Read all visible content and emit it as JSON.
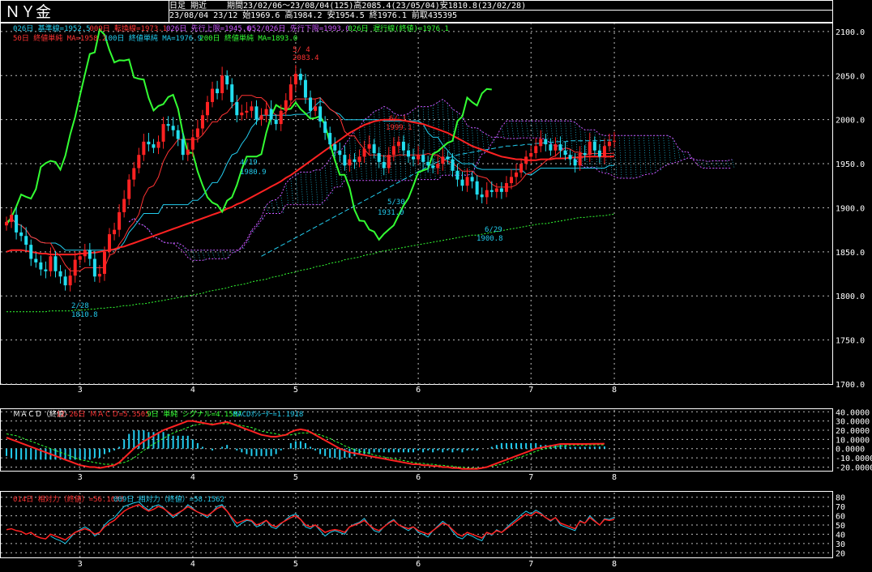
{
  "header": {
    "title": "ＮＹ金",
    "mode": "日足 期近",
    "period": "期間23/02/06～23/08/04(125)高2085.4(23/05/04)安1810.8(23/02/28)",
    "last_bar": "23/08/04 23/12 始1969.6 高1984.2 安1954.5 終1976.1 前取435395"
  },
  "legend_main": {
    "row1": [
      {
        "text": "026日 基準線=1952.5",
        "color": "#22ccee"
      },
      {
        "text": "009日 転換線=1973.1",
        "color": "#ff3333"
      },
      {
        "text": "026日 先行上限=1945.6",
        "color": "#cc55ff"
      },
      {
        "text": "052/026日 先行下限=1993.0",
        "color": "#cc55ff"
      },
      {
        "text": "026日 遅行線(終値)=1976.1",
        "color": "#33ff33"
      }
    ],
    "row2": [
      {
        "text": "50日 終値単純 MA=1958.2",
        "color": "#ff3333"
      },
      {
        "text": "100日 終値単純 MA=1976.9",
        "color": "#22ccee"
      },
      {
        "text": "200日 終値単純 MA=1893.0",
        "color": "#33ff33"
      }
    ]
  },
  "legend_macd": [
    {
      "text": "ＭＡＣＤ（終値）",
      "color": "#ffffff"
    },
    {
      "text": "12-26日 ＭＡＣＤ=5.3505",
      "color": "#ff3333"
    },
    {
      "text": "9日 単純 シグナル=4.1587",
      "color": "#33ff33"
    },
    {
      "text": "MACDｵｼﾚｰﾀｰ=1.1918",
      "color": "#22ccee"
    }
  ],
  "legend_rsi": [
    {
      "text": "014日 相対力（終値）=56.1055",
      "color": "#ff3333"
    },
    {
      "text": "009日 相対力（終値）=58.1562",
      "color": "#22ccee"
    }
  ],
  "annotations": [
    {
      "text": "5/ 4",
      "color": "#ff3333"
    },
    {
      "text": "2083.4",
      "color": "#ff3333"
    },
    {
      "text": "6/ 1",
      "color": "#ff3333"
    },
    {
      "text": "1999.1",
      "color": "#ff3333"
    },
    {
      "text": "4/19",
      "color": "#22ccee"
    },
    {
      "text": "1980.9",
      "color": "#22ccee"
    },
    {
      "text": "2/28",
      "color": "#22ccee"
    },
    {
      "text": "1810.8",
      "color": "#22ccee"
    },
    {
      "text": "5/30",
      "color": "#22ccee"
    },
    {
      "text": "1931.0",
      "color": "#22ccee"
    },
    {
      "text": "6/29",
      "color": "#22ccee"
    },
    {
      "text": "1900.8",
      "color": "#22ccee"
    }
  ],
  "colors": {
    "up": "#ff2222",
    "down": "#22ddee",
    "grid": "#bbbbbb",
    "frame": "#ffffff"
  },
  "chart_data": [
    {
      "type": "candlestick",
      "x_ticks": [
        "3",
        "4",
        "5",
        "6",
        "7",
        "8"
      ],
      "y_ticks": [
        "1700.0",
        "1750.0",
        "1800.0",
        "1850.0",
        "1900.0",
        "1950.0",
        "2000.0",
        "2050.0",
        "2100.0"
      ],
      "ylim": [
        1700,
        2110
      ],
      "close": [
        1884,
        1892,
        1872,
        1868,
        1858,
        1842,
        1838,
        1830,
        1828,
        1845,
        1828,
        1822,
        1812,
        1823,
        1841,
        1845,
        1852,
        1842,
        1822,
        1825,
        1850,
        1870,
        1875,
        1895,
        1910,
        1932,
        1945,
        1960,
        1975,
        1972,
        1968,
        1975,
        1995,
        1993,
        1988,
        1978,
        1960,
        1966,
        1980,
        1990,
        2005,
        2020,
        2035,
        2030,
        2050,
        2040,
        2020,
        2005,
        2008,
        2010,
        2015,
        2000,
        2005,
        2012,
        2000,
        1995,
        2010,
        2022,
        2040,
        2052,
        2045,
        2025,
        2010,
        2015,
        1998,
        1985,
        1972,
        1965,
        1960,
        1948,
        1955,
        1952,
        1958,
        1967,
        1972,
        1962,
        1952,
        1945,
        1960,
        1970,
        1975,
        1965,
        1958,
        1955,
        1960,
        1952,
        1948,
        1945,
        1950,
        1958,
        1955,
        1942,
        1932,
        1925,
        1935,
        1930,
        1915,
        1912,
        1920,
        1918,
        1922,
        1918,
        1928,
        1935,
        1940,
        1950,
        1958,
        1962,
        1970,
        1978,
        1972,
        1965,
        1972,
        1965,
        1960,
        1955,
        1948,
        1962,
        1960,
        1975,
        1965,
        1958,
        1970,
        1975,
        1976
      ],
      "ma50": [
        1850,
        1852,
        1852,
        1852,
        1851,
        1850,
        1849,
        1848,
        1848,
        1847,
        1847,
        1847,
        1847,
        1847,
        1847,
        1848,
        1848,
        1849,
        1849,
        1850,
        1851,
        1852,
        1853,
        1855,
        1856,
        1858,
        1860,
        1862,
        1864,
        1866,
        1868,
        1870,
        1872,
        1874,
        1876,
        1878,
        1880,
        1882,
        1884,
        1886,
        1888,
        1890,
        1892,
        1894,
        1896,
        1899,
        1901,
        1904,
        1906,
        1909,
        1912,
        1915,
        1918,
        1921,
        1924,
        1927,
        1930,
        1934,
        1937,
        1941,
        1945,
        1949,
        1953,
        1957,
        1961,
        1965,
        1969,
        1973,
        1977,
        1981,
        1985,
        1988,
        1991,
        1994,
        1996,
        1998,
        1999,
        2000,
        2000,
        2000,
        2000,
        1999,
        1998,
        1997,
        1996,
        1995,
        1993,
        1991,
        1989,
        1987,
        1985,
        1982,
        1979,
        1976,
        1973,
        1970,
        1968,
        1966,
        1964,
        1962,
        1960,
        1958,
        1957,
        1956,
        1955,
        1955,
        1954,
        1954,
        1954,
        1955,
        1955,
        1955,
        1956,
        1956,
        1956,
        1957,
        1957,
        1957,
        1958,
        1958,
        1958,
        1958,
        1958,
        1958,
        1958.2
      ],
      "ma100": [
        null,
        null,
        null,
        null,
        null,
        null,
        null,
        null,
        null,
        null,
        null,
        null,
        null,
        null,
        null,
        null,
        null,
        null,
        null,
        null,
        null,
        null,
        null,
        null,
        null,
        null,
        null,
        null,
        null,
        null,
        null,
        null,
        null,
        null,
        null,
        null,
        null,
        null,
        null,
        null,
        null,
        null,
        null,
        null,
        null,
        null,
        null,
        null,
        null,
        null,
        null,
        null,
        1845,
        1848,
        1851,
        1854,
        1857,
        1860,
        1863,
        1866,
        1869,
        1872,
        1875,
        1878,
        1881,
        1884,
        1887,
        1890,
        1893,
        1896,
        1899,
        1902,
        1905,
        1908,
        1911,
        1914,
        1917,
        1920,
        1923,
        1926,
        1929,
        1932,
        1935,
        1938,
        1941,
        1944,
        1947,
        1950,
        1952,
        1954,
        1956,
        1958,
        1960,
        1961,
        1962,
        1963,
        1964,
        1965,
        1966,
        1967,
        1968,
        1969,
        1970,
        1970,
        1971,
        1971,
        1972,
        1972,
        1973,
        1973,
        1974,
        1974,
        1975,
        1975,
        1975,
        1976,
        1976,
        1976,
        1976,
        1976,
        1976,
        1976,
        1976.5,
        1976.7,
        1976.9
      ],
      "ma200": [
        1782,
        1782,
        1782,
        1782,
        1782,
        1782,
        1782,
        1782,
        1782,
        1783,
        1783,
        1783,
        1783,
        1783,
        1784,
        1784,
        1784,
        1785,
        1785,
        1786,
        1786,
        1787,
        1787,
        1788,
        1789,
        1789,
        1790,
        1791,
        1791,
        1792,
        1793,
        1794,
        1795,
        1796,
        1797,
        1798,
        1799,
        1800,
        1801,
        1802,
        1803,
        1805,
        1806,
        1807,
        1808,
        1809,
        1811,
        1812,
        1813,
        1814,
        1816,
        1817,
        1818,
        1819,
        1821,
        1822,
        1823,
        1825,
        1826,
        1827,
        1829,
        1830,
        1831,
        1833,
        1834,
        1835,
        1837,
        1838,
        1839,
        1841,
        1842,
        1843,
        1844,
        1846,
        1847,
        1848,
        1850,
        1851,
        1852,
        1853,
        1854,
        1855,
        1856,
        1857,
        1858,
        1859,
        1860,
        1861,
        1862,
        1863,
        1864,
        1865,
        1866,
        1867,
        1868,
        1869,
        1869,
        1870,
        1871,
        1872,
        1873,
        1874,
        1875,
        1876,
        1877,
        1878,
        1879,
        1880,
        1881,
        1882,
        1882,
        1883,
        1884,
        1885,
        1886,
        1887,
        1888,
        1889,
        1889,
        1890,
        1890,
        1891,
        1891,
        1892,
        1893
      ]
    },
    {
      "type": "line",
      "name": "MACD",
      "y_ticks": [
        "40.0000",
        "30.0000",
        "20.0000",
        "10.0000",
        "0.0000",
        "-10.0000",
        "-20.0000"
      ],
      "ylim": [
        -24,
        42
      ],
      "macd": [
        12,
        10,
        8,
        6,
        4,
        2,
        0,
        -2,
        -4,
        -6,
        -8,
        -10,
        -12,
        -14,
        -16,
        -18,
        -19,
        -20,
        -20,
        -21,
        -20,
        -19,
        -18,
        -15,
        -10,
        -5,
        0,
        4,
        8,
        11,
        14,
        17,
        20,
        22,
        24,
        26,
        28,
        30,
        30,
        29,
        28,
        27,
        26,
        27,
        28,
        29,
        27,
        25,
        23,
        21,
        19,
        17,
        15,
        14,
        13,
        13,
        14,
        15,
        18,
        20,
        21,
        20,
        18,
        15,
        12,
        9,
        6,
        3,
        0,
        -2,
        -4,
        -5,
        -6,
        -7,
        -8,
        -9,
        -10,
        -11,
        -12,
        -13,
        -14,
        -15,
        -16,
        -17,
        -17,
        -18,
        -18,
        -19,
        -19,
        -20,
        -20,
        -21,
        -21,
        -22,
        -22,
        -22,
        -22,
        -21,
        -20,
        -18,
        -16,
        -14,
        -12,
        -10,
        -8,
        -6,
        -4,
        -2,
        0,
        1,
        2,
        3,
        4,
        5,
        5,
        5,
        5,
        5,
        5,
        5.1,
        5.2,
        5.3,
        5.35
      ],
      "signal": [
        16,
        15,
        14,
        12,
        10,
        8,
        6,
        4,
        2,
        0,
        -2,
        -4,
        -6,
        -8,
        -10,
        -12,
        -13,
        -14,
        -15,
        -16,
        -17,
        -17,
        -17,
        -16,
        -15,
        -13,
        -10,
        -6,
        -2,
        2,
        5,
        8,
        11,
        14,
        17,
        19,
        21,
        23,
        25,
        26,
        27,
        27,
        27,
        27,
        27,
        27,
        27,
        26,
        25,
        24,
        23,
        21,
        19,
        18,
        17,
        16,
        15,
        15,
        15,
        16,
        17,
        17,
        17,
        16,
        15,
        13,
        11,
        8,
        6,
        3,
        1,
        -1,
        -3,
        -4,
        -5,
        -7,
        -8,
        -9,
        -10,
        -11,
        -12,
        -13,
        -14,
        -15,
        -16,
        -16,
        -17,
        -17,
        -18,
        -18,
        -19,
        -19,
        -20,
        -20,
        -21,
        -21,
        -21,
        -21,
        -20,
        -19,
        -18,
        -17,
        -15,
        -13,
        -11,
        -9,
        -7,
        -5,
        -3,
        -1,
        0,
        1,
        2,
        3,
        3,
        4,
        4,
        4,
        4,
        4,
        4.1,
        4.15,
        4.16
      ]
    },
    {
      "type": "line",
      "name": "RSI",
      "y_ticks": [
        "80",
        "70",
        "60",
        "50",
        "40",
        "30",
        "20"
      ],
      "ylim": [
        15,
        85
      ],
      "rsi14": [
        45,
        46,
        44,
        43,
        40,
        42,
        38,
        36,
        35,
        40,
        38,
        36,
        34,
        38,
        42,
        44,
        46,
        44,
        40,
        42,
        48,
        52,
        55,
        60,
        65,
        68,
        70,
        72,
        68,
        65,
        67,
        70,
        68,
        64,
        60,
        63,
        66,
        70,
        67,
        64,
        62,
        60,
        64,
        68,
        70,
        65,
        58,
        52,
        54,
        56,
        55,
        50,
        52,
        55,
        50,
        48,
        52,
        55,
        58,
        60,
        56,
        50,
        48,
        50,
        46,
        42,
        44,
        45,
        44,
        42,
        48,
        50,
        52,
        55,
        50,
        46,
        44,
        48,
        52,
        55,
        50,
        48,
        46,
        48,
        44,
        42,
        40,
        44,
        48,
        52,
        50,
        45,
        40,
        38,
        42,
        40,
        38,
        36,
        42,
        40,
        44,
        42,
        46,
        50,
        54,
        58,
        62,
        60,
        64,
        62,
        58,
        55,
        58,
        52,
        50,
        48,
        46,
        54,
        52,
        58,
        54,
        50,
        56,
        55,
        56.1
      ],
      "rsi9": [
        null,
        null,
        null,
        null,
        null,
        null,
        null,
        null,
        null,
        38,
        35,
        33,
        30,
        36,
        42,
        45,
        48,
        45,
        38,
        42,
        50,
        55,
        58,
        64,
        70,
        72,
        74,
        75,
        70,
        66,
        70,
        72,
        69,
        63,
        58,
        62,
        66,
        72,
        68,
        64,
        61,
        58,
        64,
        70,
        72,
        65,
        56,
        48,
        52,
        55,
        54,
        48,
        50,
        55,
        48,
        46,
        51,
        56,
        60,
        62,
        56,
        48,
        46,
        50,
        44,
        38,
        42,
        44,
        42,
        40,
        48,
        51,
        53,
        57,
        50,
        44,
        42,
        48,
        53,
        56,
        50,
        47,
        44,
        48,
        42,
        40,
        37,
        44,
        49,
        54,
        50,
        43,
        37,
        35,
        40,
        38,
        35,
        33,
        42,
        39,
        45,
        42,
        47,
        52,
        56,
        61,
        65,
        62,
        66,
        63,
        58,
        54,
        58,
        50,
        48,
        46,
        44,
        55,
        52,
        60,
        55,
        50,
        57,
        56,
        58.2
      ]
    }
  ]
}
